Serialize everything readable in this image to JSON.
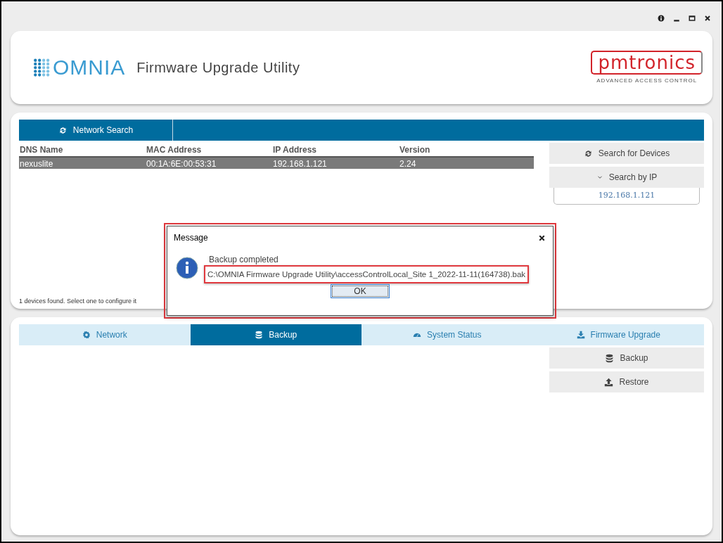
{
  "header": {
    "logo_text": "OMNIA",
    "title": "Firmware Upgrade Utility",
    "brand": "pmtronics",
    "brand_tagline": "ADVANCED ACCESS CONTROL"
  },
  "search_panel": {
    "tabs": [
      {
        "label": "Network Search",
        "selected": true
      }
    ],
    "table": {
      "columns": [
        "DNS Name",
        "MAC Address",
        "IP Address",
        "Version"
      ],
      "rows": [
        {
          "cells": [
            "nexuslite",
            "00:1A:6E:00:53:31",
            "192.168.1.121",
            "2.24"
          ],
          "selected": true
        }
      ]
    },
    "buttons": [
      {
        "label": "Search for Devices"
      },
      {
        "label": "Search by IP"
      }
    ],
    "ip_field": {
      "value": "192.168.1.121"
    },
    "status": "1 devices found. Select one to configure it"
  },
  "config_panel": {
    "tabs": [
      {
        "label": "Network",
        "selected": false
      },
      {
        "label": "Backup",
        "selected": true
      },
      {
        "label": "System Status",
        "selected": false
      },
      {
        "label": "Firmware Upgrade",
        "selected": false
      }
    ],
    "buttons": [
      {
        "label": "Backup"
      },
      {
        "label": "Restore"
      }
    ]
  },
  "dialog": {
    "title": "Message",
    "message": "Backup completed",
    "path": "C:\\OMNIA Firmware Upgrade Utility\\accessControlLocal_Site 1_2022-11-11(164738).bak",
    "ok": "OK"
  }
}
